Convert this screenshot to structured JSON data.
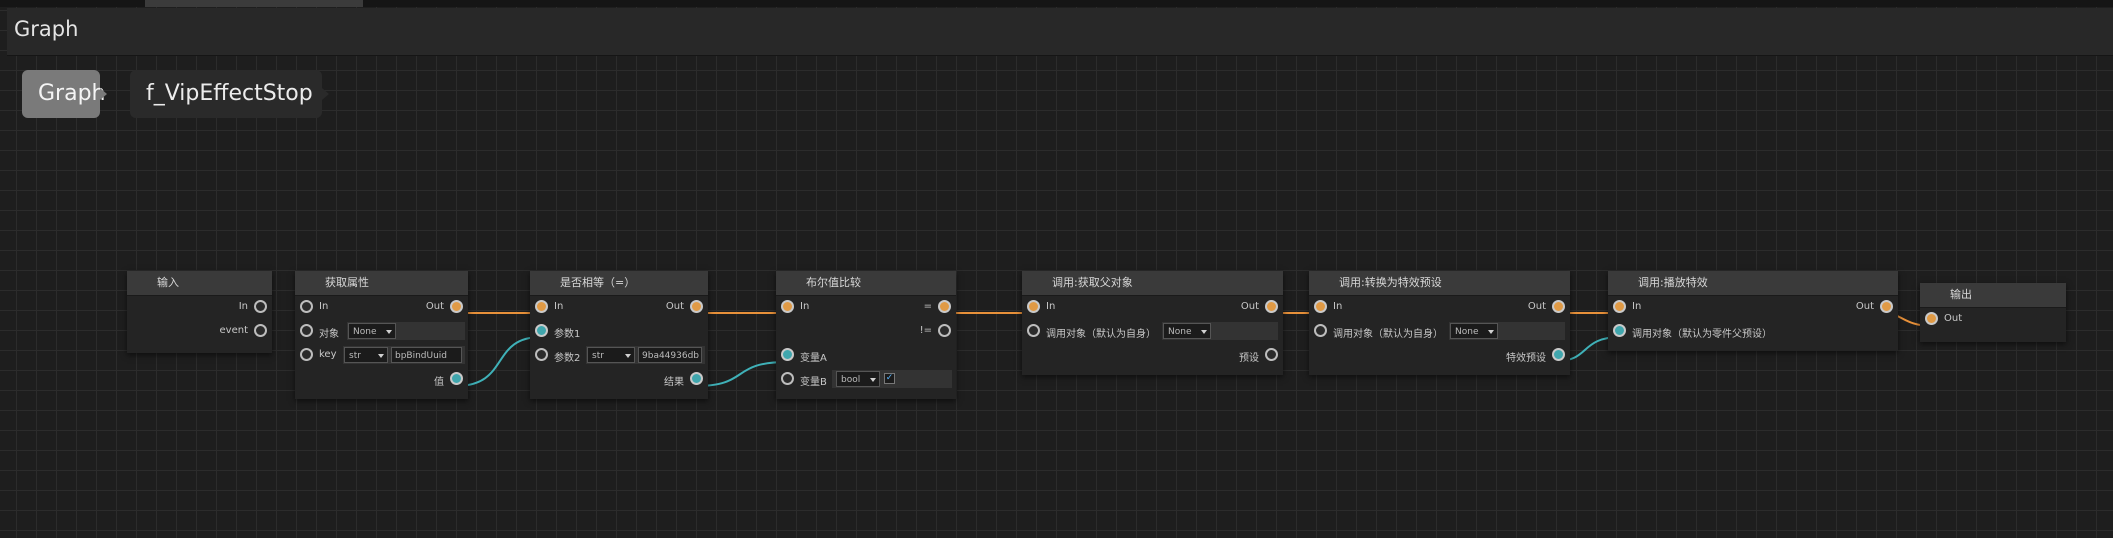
{
  "window": {
    "title": "Graph"
  },
  "breadcrumbs": [
    "Graph",
    "f_VipEffectStop"
  ],
  "colors": {
    "exec_wire": "#e8913a",
    "data_wire": "#3fb1b8"
  },
  "nodes": {
    "input": {
      "title": "输入",
      "ports": {
        "in": "In",
        "event": "event"
      }
    },
    "get_attr": {
      "title": "获取属性",
      "in": "In",
      "out": "Out",
      "object_label": "对象",
      "object_value": "None",
      "key_label": "key",
      "key_type": "str",
      "key_value": "bpBindUuid",
      "value_label": "值"
    },
    "is_equal": {
      "title": "是否相等（=）",
      "in": "In",
      "out": "Out",
      "param1_label": "参数1",
      "param2_label": "参数2",
      "param2_type": "str",
      "param2_value": "9ba44936db",
      "result_label": "结果"
    },
    "bool_compare": {
      "title": "布尔值比较",
      "in": "In",
      "eq": "=",
      "neq": "!=",
      "var_a_label": "变量A",
      "var_b_label": "变量B",
      "var_b_type": "bool"
    },
    "get_parent": {
      "title": "调用:获取父对象",
      "in": "In",
      "out": "Out",
      "caller_label": "调用对象（默认为自身）",
      "caller_value": "None",
      "preset_label": "预设"
    },
    "to_effect_preset": {
      "title": "调用:转换为特效预设",
      "in": "In",
      "out": "Out",
      "caller_label": "调用对象（默认为自身）",
      "caller_value": "None",
      "effect_preset_label": "特效预设"
    },
    "play_effect": {
      "title": "调用:播放特效",
      "in": "In",
      "out": "Out",
      "caller_label": "调用对象（默认为零件父预设）"
    },
    "output": {
      "title": "输出",
      "out": "Out"
    }
  }
}
